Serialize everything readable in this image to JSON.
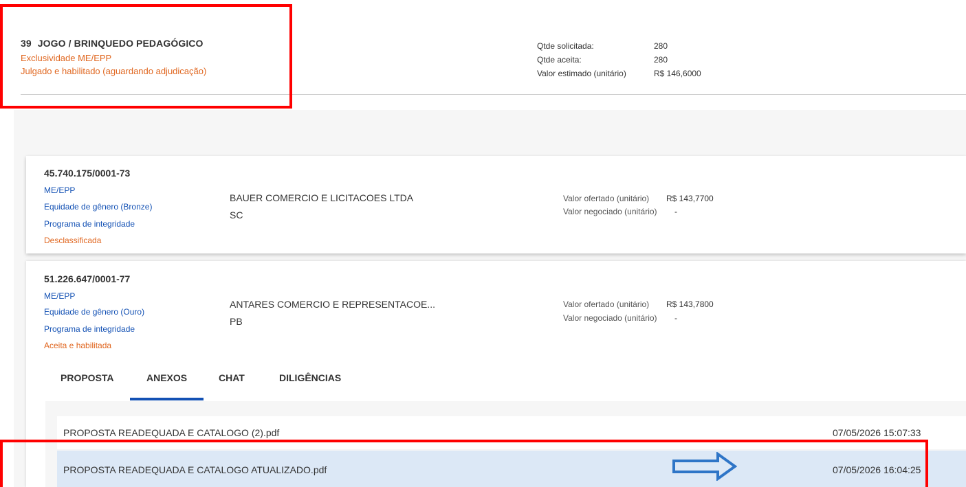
{
  "item": {
    "number": "39",
    "title": "JOGO / BRINQUEDO PEDAGÓGICO",
    "exclusivity": "Exclusividade ME/EPP",
    "status": "Julgado e habilitado (aguardando adjudicação)"
  },
  "quantities": {
    "requested_label": "Qtde solicitada:",
    "requested_value": "280",
    "accepted_label": "Qtde aceita:",
    "accepted_value": "280",
    "estimated_label": "Valor estimado (unitário)",
    "estimated_value": "R$ 146,6000"
  },
  "bidders": [
    {
      "cnpj": "45.740.175/0001-73",
      "size": "ME/EPP",
      "equity": "Equidade de gênero (Bronze)",
      "integrity": "Programa de integridade",
      "status": "Desclassificada",
      "company": "BAUER COMERCIO E LICITACOES LTDA",
      "uf": "SC",
      "offered_label": "Valor ofertado (unitário)",
      "offered_value": "R$ 143,7700",
      "negotiated_label": "Valor negociado (unitário)",
      "negotiated_value": "-"
    },
    {
      "cnpj": "51.226.647/0001-77",
      "size": "ME/EPP",
      "equity": "Equidade de gênero (Ouro)",
      "integrity": "Programa de integridade",
      "status": "Aceita e habilitada",
      "company": "ANTARES COMERCIO E REPRESENTACOE...",
      "uf": "PB",
      "offered_label": "Valor ofertado (unitário)",
      "offered_value": "R$ 143,7800",
      "negotiated_label": "Valor negociado (unitário)",
      "negotiated_value": "-"
    }
  ],
  "tabs": [
    {
      "label": "PROPOSTA"
    },
    {
      "label": "ANEXOS",
      "active": true
    },
    {
      "label": "CHAT"
    },
    {
      "label": "DILIGÊNCIAS"
    }
  ],
  "attachments": [
    {
      "name": "PROPOSTA READEQUADA E CATALOGO (2).pdf",
      "date": "07/05/2026 15:07:33"
    },
    {
      "name": "PROPOSTA READEQUADA E CATALOGO ATUALIZADO.pdf",
      "date": "07/05/2026 16:04:25",
      "highlighted": true
    }
  ],
  "colors": {
    "accent_blue": "#1351b4",
    "status_orange": "#e0661f",
    "annotation_red": "#ff0000",
    "arrow_blue": "#2e75c7",
    "highlight_row": "#dce8f6"
  },
  "icons": {
    "annotation_arrow": "right-arrow-icon"
  }
}
